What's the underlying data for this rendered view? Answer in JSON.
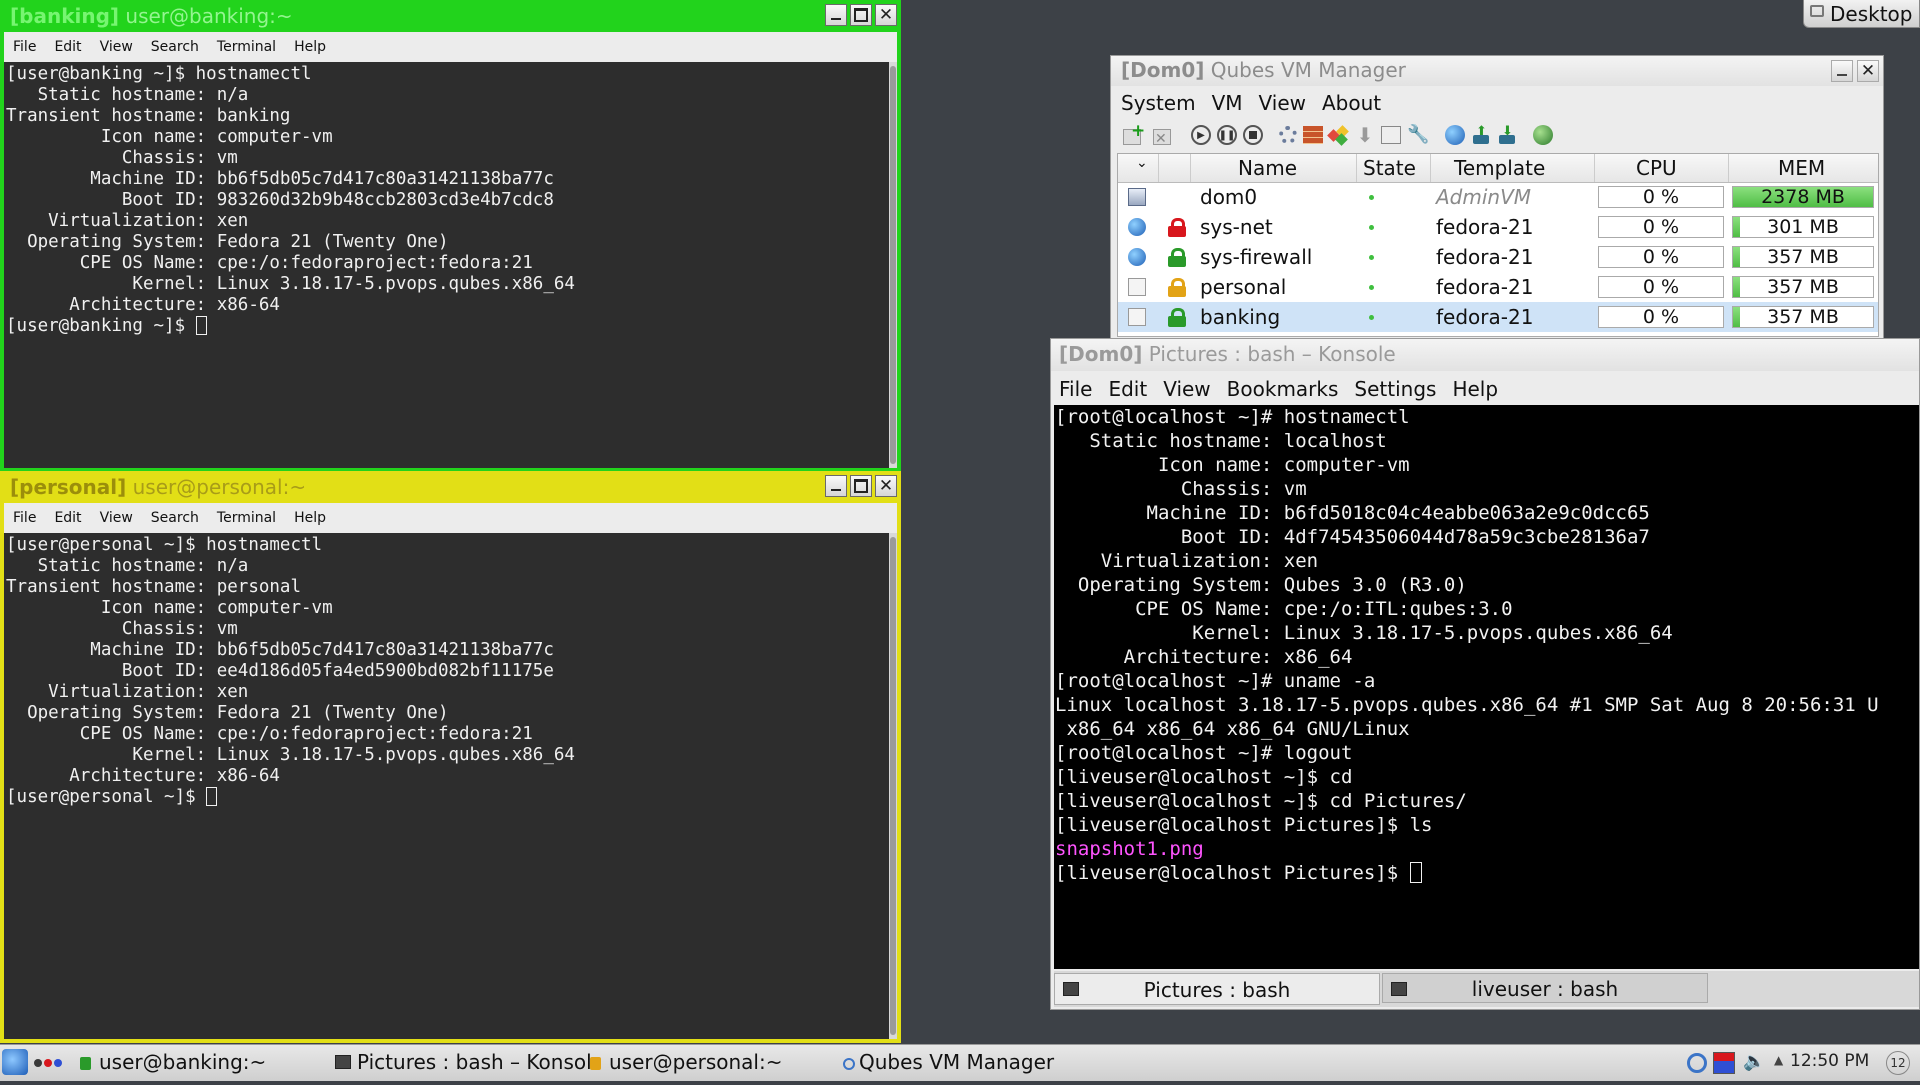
{
  "desktop": {
    "label": "Desktop"
  },
  "banking": {
    "tag": "[banking]",
    "title": "user@banking:~",
    "color": "#22d31c",
    "menu": [
      "File",
      "Edit",
      "View",
      "Search",
      "Terminal",
      "Help"
    ],
    "lines": [
      "[user@banking ~]$ hostnamectl",
      "   Static hostname: n/a",
      "Transient hostname: banking",
      "         Icon name: computer-vm",
      "           Chassis: vm",
      "        Machine ID: bb6f5db05c7d417c80a31421138ba77c",
      "           Boot ID: 983260d32b9b48ccb2803cd3e4b7cdc8",
      "    Virtualization: xen",
      "  Operating System: Fedora 21 (Twenty One)",
      "       CPE OS Name: cpe:/o:fedoraproject:fedora:21",
      "            Kernel: Linux 3.18.17-5.pvops.qubes.x86_64",
      "      Architecture: x86-64"
    ],
    "prompt": "[user@banking ~]$ "
  },
  "personal": {
    "tag": "[personal]",
    "title": "user@personal:~",
    "color": "#e2df16",
    "menu": [
      "File",
      "Edit",
      "View",
      "Search",
      "Terminal",
      "Help"
    ],
    "lines": [
      "[user@personal ~]$ hostnamectl",
      "   Static hostname: n/a",
      "Transient hostname: personal",
      "         Icon name: computer-vm",
      "           Chassis: vm",
      "        Machine ID: bb6f5db05c7d417c80a31421138ba77c",
      "           Boot ID: ee4d186d05fa4ed5900bd082bf11175e",
      "    Virtualization: xen",
      "  Operating System: Fedora 21 (Twenty One)",
      "       CPE OS Name: cpe:/o:fedoraproject:fedora:21",
      "            Kernel: Linux 3.18.17-5.pvops.qubes.x86_64",
      "      Architecture: x86-64"
    ],
    "prompt": "[user@personal ~]$ "
  },
  "vmm": {
    "tag": "[Dom0]",
    "title": "Qubes VM Manager",
    "menu": [
      "System",
      "VM",
      "View",
      "About"
    ],
    "headers": {
      "name": "Name",
      "state": "State",
      "template": "Template",
      "cpu": "CPU",
      "mem": "MEM"
    },
    "rows": [
      {
        "name": "dom0",
        "template": "AdminVM",
        "cpu": "0 %",
        "mem": "2378 MB",
        "mem_fraction": 1.0,
        "lock": "",
        "lock_color": ""
      },
      {
        "name": "sys-net",
        "template": "fedora-21",
        "cpu": "0 %",
        "mem": "301 MB",
        "mem_fraction": 0.05,
        "lock": "lock",
        "lock_color": "#d8171d"
      },
      {
        "name": "sys-firewall",
        "template": "fedora-21",
        "cpu": "0 %",
        "mem": "357 MB",
        "mem_fraction": 0.05,
        "lock": "lock",
        "lock_color": "#2a9a2a"
      },
      {
        "name": "personal",
        "template": "fedora-21",
        "cpu": "0 %",
        "mem": "357 MB",
        "mem_fraction": 0.05,
        "lock": "lock",
        "lock_color": "#e2a317"
      },
      {
        "name": "banking",
        "template": "fedora-21",
        "cpu": "0 %",
        "mem": "357 MB",
        "mem_fraction": 0.05,
        "lock": "lock",
        "lock_color": "#2a9a2a"
      }
    ]
  },
  "konsole": {
    "tag": "[Dom0]",
    "title": "Pictures : bash – Konsole",
    "menu": [
      "File",
      "Edit",
      "View",
      "Bookmarks",
      "Settings",
      "Help"
    ],
    "lines": [
      "[root@localhost ~]# hostnamectl",
      "   Static hostname: localhost",
      "         Icon name: computer-vm",
      "           Chassis: vm",
      "        Machine ID: b6fd5018c04c4eabbe063a2e9c0dcc65",
      "           Boot ID: 4df74543506044d78a59c3cbe28136a7",
      "    Virtualization: xen",
      "  Operating System: Qubes 3.0 (R3.0)",
      "       CPE OS Name: cpe:/o:ITL:qubes:3.0",
      "            Kernel: Linux 3.18.17-5.pvops.qubes.x86_64",
      "      Architecture: x86_64",
      "[root@localhost ~]# uname -a",
      "Linux localhost 3.18.17-5.pvops.qubes.x86_64 #1 SMP Sat Aug 8 20:56:31 U",
      " x86_64 x86_64 x86_64 GNU/Linux",
      "[root@localhost ~]# logout",
      "[liveuser@localhost ~]$ cd",
      "[liveuser@localhost ~]$ cd Pictures/",
      "[liveuser@localhost Pictures]$ ls"
    ],
    "file": "snapshot1.png",
    "prompt": "[liveuser@localhost Pictures]$ ",
    "tabs": [
      "Pictures : bash",
      "liveuser : bash"
    ]
  },
  "taskbar": {
    "tasks": [
      "user@banking:~",
      "Pictures : bash – Konsol",
      "user@personal:~",
      "Qubes VM Manager"
    ],
    "clock": "12:50 PM",
    "badge": "12"
  }
}
